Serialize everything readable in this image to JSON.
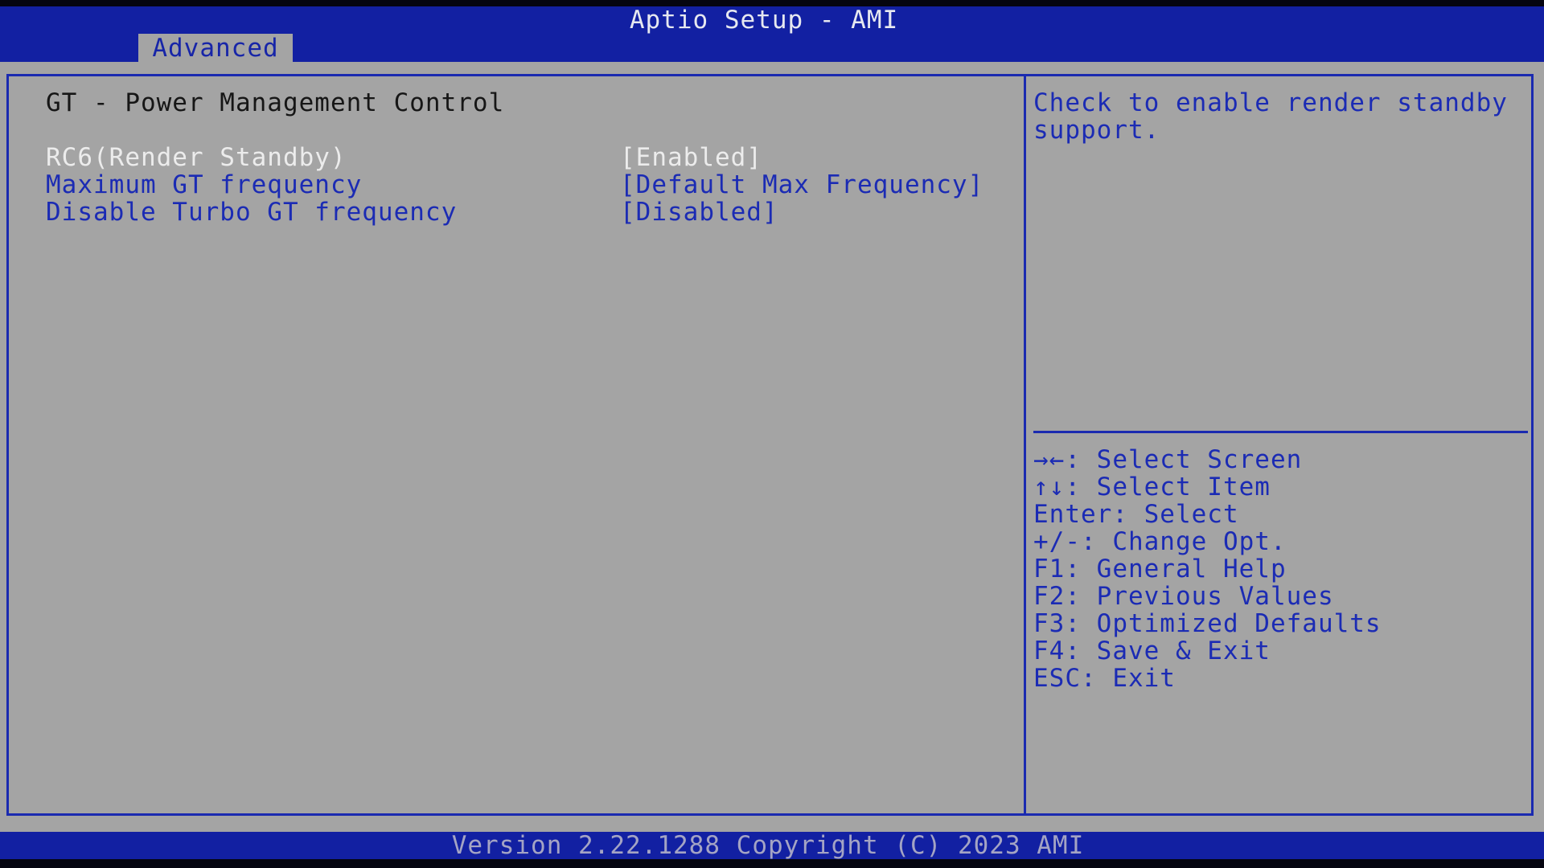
{
  "header": {
    "title": "Aptio Setup - AMI",
    "active_tab": "Advanced"
  },
  "section": {
    "title": "GT - Power Management Control"
  },
  "settings": [
    {
      "label": "RC6(Render Standby)",
      "value": "[Enabled]",
      "selected": true
    },
    {
      "label": "Maximum GT frequency",
      "value": "[Default Max Frequency]",
      "selected": false
    },
    {
      "label": "Disable Turbo GT frequency",
      "value": "[Disabled]",
      "selected": false
    }
  ],
  "help": {
    "line1": "Check to enable render standby",
    "line2": "support."
  },
  "keys": [
    "→←: Select Screen",
    "↑↓: Select Item",
    "Enter: Select",
    "+/-: Change Opt.",
    "F1: General Help",
    "F2: Previous Values",
    "F3: Optimized Defaults",
    "F4: Save & Exit",
    "ESC: Exit"
  ],
  "footer": {
    "text": "Version 2.22.1288 Copyright (C) 2023 AMI"
  },
  "colors": {
    "header_bg": "#1220a2",
    "body_bg": "#a4a4a4",
    "item_text": "#1b2bb4",
    "selected_text": "#ececec"
  }
}
